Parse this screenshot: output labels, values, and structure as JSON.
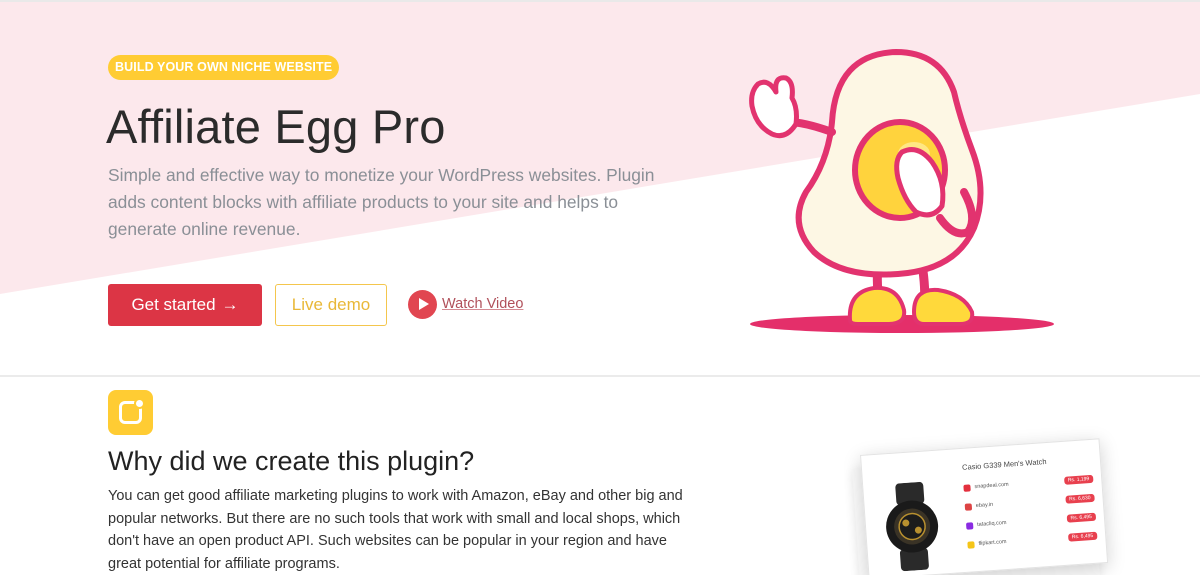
{
  "hero": {
    "badge": "BUILD YOUR OWN NICHE WEBSITE",
    "title": "Affiliate Egg Pro",
    "description": "Simple and effective way to monetize your WordPress websites. Plugin adds content blocks with affiliate products to your site and helps to generate online revenue.",
    "primary_button": "Get started",
    "primary_button_icon": "arrow-right-icon",
    "secondary_button": "Live demo",
    "video_link": "Watch Video",
    "video_icon": "play-icon",
    "colors": {
      "background_pink": "#fce8ec",
      "accent_red": "#dc3545",
      "accent_yellow": "#ffcc33"
    }
  },
  "section": {
    "icon": "notification-icon",
    "title": "Why did we create this plugin?",
    "text": "You can get good affiliate marketing plugins to work with Amazon, eBay and other big and popular networks. But there are no such tools that work with small and local shops, which don't have an open product API. Such websites can be popular in your region and have great potential for affiliate programs."
  },
  "product_card": {
    "title": "Casio G339 Men's Watch",
    "shops": [
      {
        "name": "snapdeal.com",
        "price": "Rs. 1,199"
      },
      {
        "name": "ebay.in",
        "price": "Rs. 6,630"
      },
      {
        "name": "tatacliq.com",
        "price": "Rs. 6,495"
      },
      {
        "name": "flipkart.com",
        "price": "Rs. 6,495"
      }
    ]
  }
}
